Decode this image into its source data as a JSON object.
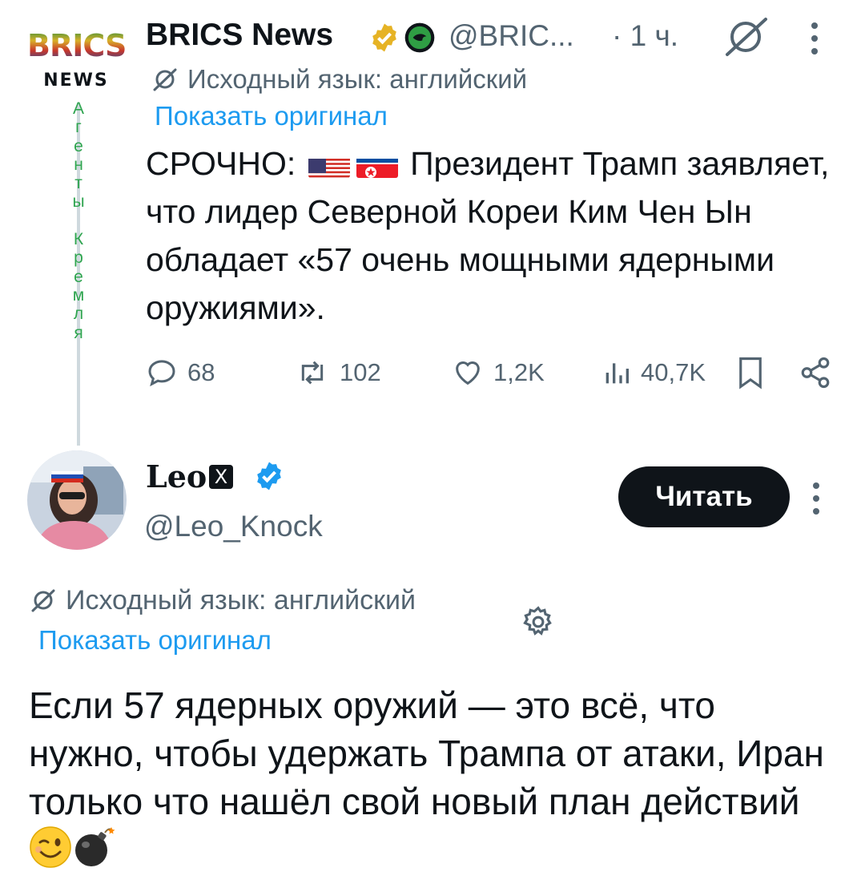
{
  "tweet1": {
    "author": {
      "name": "BRICS News",
      "handle": "@BRIC...",
      "logo_text": "BRICS",
      "logo_subtext": "NEWS"
    },
    "time": "· 1 ч.",
    "label_vertical": [
      "А",
      "г",
      "е",
      "н",
      "т",
      "ы",
      "",
      "К",
      "р",
      "е",
      "м",
      "л",
      "я"
    ],
    "translation": {
      "source_language": "Исходный язык: английский",
      "show_original": "Показать оригинал"
    },
    "body_prefix": "СРОЧНО:",
    "body_text": "Президент Трамп заявляет, что лидер Северной Кореи Ким Чен Ын обладает «57 очень мощными ядерными оружиями».",
    "flags": [
      "us-flag",
      "north-korea-flag"
    ],
    "stats": {
      "replies": "68",
      "reposts": "102",
      "likes": "1,2K",
      "views": "40,7K"
    }
  },
  "tweet2": {
    "author": {
      "name": "Leo",
      "x_badge": "X",
      "handle": "@Leo_Knock"
    },
    "follow_label": "Читать",
    "translation": {
      "source_language": "Исходный язык: английский",
      "show_original": "Показать оригинал"
    },
    "body_text": "Если 57 ядерных оружий — это всё, что нужно, чтобы удержать Трампа от атаки, Иран только что нашёл свой новый план действий",
    "emojis": [
      "winking-face",
      "bomb"
    ]
  },
  "colors": {
    "text": "#0f1419",
    "secondary": "#536471",
    "link": "#1d9bf0",
    "gold_badge": "#e6b325",
    "verified_blue": "#1d9bf0",
    "vertical_label": "#2ea44f"
  }
}
